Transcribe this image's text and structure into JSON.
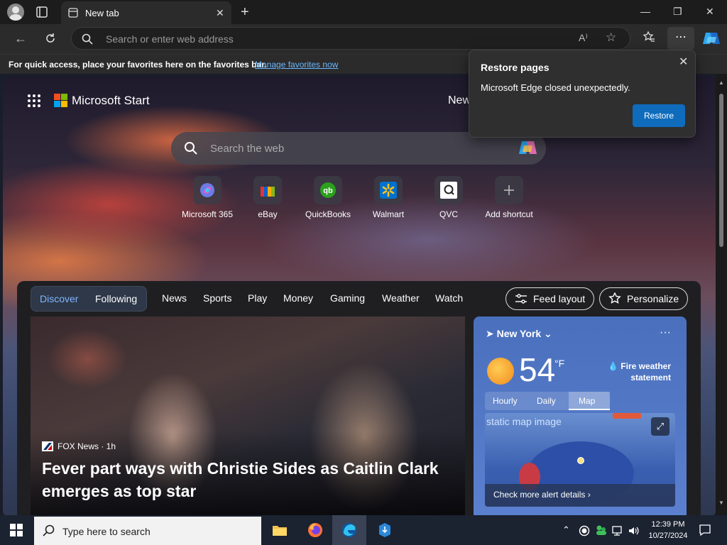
{
  "browser": {
    "tab_title": "New tab",
    "tab_close": "✕",
    "new_tab": "+",
    "address_placeholder": "Search or enter web address",
    "read_aloud": "A⁾",
    "more": "⋯",
    "window_controls": {
      "minimize": "—",
      "restore": "❐",
      "close": "✕"
    }
  },
  "favbar": {
    "message": "For quick access, place your favorites here on the favorites bar.",
    "link": "Manage favorites now"
  },
  "restore_popup": {
    "title": "Restore pages",
    "body": "Microsoft Edge closed unexpectedly.",
    "button": "Restore",
    "close": "✕"
  },
  "start_page": {
    "brand": "Microsoft Start",
    "news_clip": "New",
    "search_placeholder": "Search the web",
    "shortcuts": [
      {
        "label": "Microsoft 365",
        "icon": "microsoft-365-icon"
      },
      {
        "label": "eBay",
        "icon": "ebay-icon"
      },
      {
        "label": "QuickBooks",
        "icon": "quickbooks-icon"
      },
      {
        "label": "Walmart",
        "icon": "walmart-icon"
      },
      {
        "label": "QVC",
        "icon": "qvc-icon"
      },
      {
        "label": "Add shortcut",
        "icon": "plus-icon"
      }
    ]
  },
  "feed": {
    "tabs": [
      "Discover",
      "Following"
    ],
    "nav": [
      "News",
      "Sports",
      "Play",
      "Money",
      "Gaming",
      "Weather",
      "Watch"
    ],
    "feed_layout": "Feed layout",
    "personalize": "Personalize",
    "hero": {
      "source": "FOX News · 1h",
      "headline": "Fever part ways with Christie Sides as Caitlin Clark emerges as top star"
    },
    "weather": {
      "location": "New York",
      "temperature": "54",
      "unit": "°F",
      "alert": "Fire weather statement",
      "tabs": [
        "Hourly",
        "Daily",
        "Map"
      ],
      "active_tab": "Map",
      "map_alt": "static map image",
      "map_footer": "Check more alert details ›",
      "more": "···"
    }
  },
  "taskbar": {
    "search_placeholder": "Type here to search",
    "time": "12:39 PM",
    "date": "10/27/2024"
  },
  "colors": {
    "accent": "#0f6cbd",
    "link": "#6cb8ff",
    "weather_card": "#4a70bd",
    "taskbar": "#1b2230"
  }
}
